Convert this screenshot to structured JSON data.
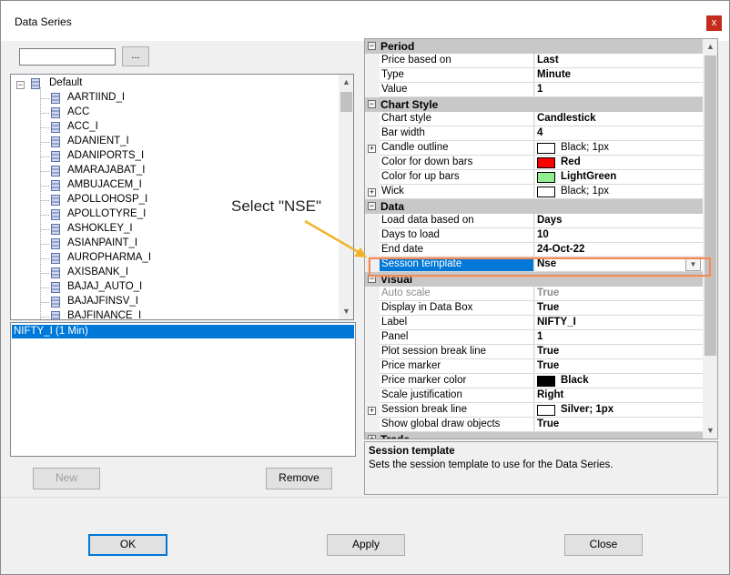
{
  "window": {
    "title": "Data Series",
    "close_glyph": "x"
  },
  "left": {
    "browse_label": "...",
    "tree_root": "Default",
    "instruments": [
      "AARTIIND_I",
      "ACC",
      "ACC_I",
      "ADANIENT_I",
      "ADANIPORTS_I",
      "AMARAJABAT_I",
      "AMBUJACEM_I",
      "APOLLOHOSP_I",
      "APOLLOTYRE_I",
      "ASHOKLEY_I",
      "ASIANPAINT_I",
      "AUROPHARMA_I",
      "AXISBANK_I",
      "BAJAJ_AUTO_I",
      "BAJAJFINSV_I",
      "BAJFINANCE_I"
    ],
    "selected_series": "NIFTY_I (1 Min)",
    "new_label": "New",
    "remove_label": "Remove"
  },
  "grid": {
    "period": {
      "header": "Period",
      "rows": [
        {
          "name": "Price based on",
          "value": "Last"
        },
        {
          "name": "Type",
          "value": "Minute"
        },
        {
          "name": "Value",
          "value": "1"
        }
      ]
    },
    "chart_style": {
      "header": "Chart Style",
      "rows": [
        {
          "name": "Chart style",
          "value": "Candlestick"
        },
        {
          "name": "Bar width",
          "value": "4"
        },
        {
          "name": "Candle outline",
          "value": "Black; 1px",
          "color": "#ffffff"
        },
        {
          "name": "Color for down bars",
          "value": "Red",
          "color": "#ff0000"
        },
        {
          "name": "Color for up bars",
          "value": "LightGreen",
          "color": "#90ee90"
        },
        {
          "name": "Wick",
          "value": "Black; 1px",
          "color": "#ffffff"
        }
      ]
    },
    "data": {
      "header": "Data",
      "rows": [
        {
          "name": "Load data based on",
          "value": "Days"
        },
        {
          "name": "Days to load",
          "value": "10"
        },
        {
          "name": "End date",
          "value": "24-Oct-22"
        },
        {
          "name": "Session template",
          "value": "Nse"
        }
      ]
    },
    "visual": {
      "header": "Visual",
      "rows": [
        {
          "name": "Auto scale",
          "value": "True"
        },
        {
          "name": "Display in Data Box",
          "value": "True"
        },
        {
          "name": "Label",
          "value": "NIFTY_I"
        },
        {
          "name": "Panel",
          "value": "1"
        },
        {
          "name": "Plot session break line",
          "value": "True"
        },
        {
          "name": "Price marker",
          "value": "True"
        },
        {
          "name": "Price marker color",
          "value": "Black",
          "color": "#000000"
        },
        {
          "name": "Scale justification",
          "value": "Right"
        },
        {
          "name": "Session break line",
          "value": "Silver; 1px",
          "color": "#ffffff"
        },
        {
          "name": "Show global draw objects",
          "value": "True"
        }
      ]
    },
    "next_header": "Trade"
  },
  "description": {
    "title": "Session template",
    "text": "Sets the session template to use for the Data Series."
  },
  "annotation": {
    "text": "Select \"NSE\"",
    "color": "#f0b429"
  },
  "footer": {
    "ok_label": "OK",
    "apply_label": "Apply",
    "close_label": "Close"
  },
  "colors": {
    "selection": "#0078d7",
    "highlight_box": "#f08a5a",
    "close_button": "#c42b1c"
  }
}
